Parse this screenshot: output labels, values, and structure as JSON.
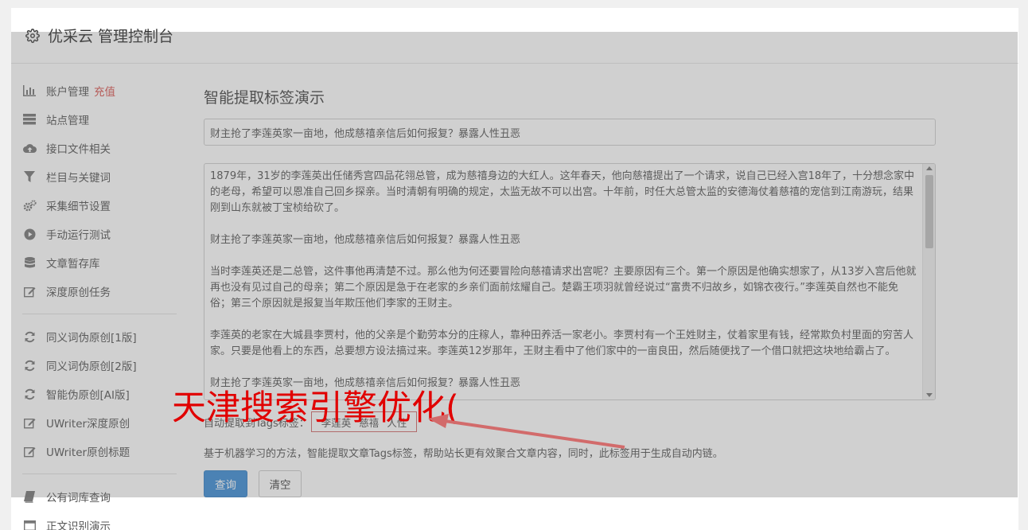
{
  "header": {
    "title": "优采云 管理控制台",
    "icon": "gear-icon"
  },
  "sidebar": {
    "group1": [
      {
        "label": "账户管理",
        "badge": "充值",
        "icon": "bar-chart-icon"
      },
      {
        "label": "站点管理",
        "icon": "server-list-icon"
      },
      {
        "label": "接口文件相关",
        "icon": "cloud-upload-icon"
      },
      {
        "label": "栏目与关键词",
        "icon": "filter-icon"
      },
      {
        "label": "采集细节设置",
        "icon": "gears-icon"
      },
      {
        "label": "手动运行测试",
        "icon": "play-circle-icon"
      },
      {
        "label": "文章暂存库",
        "icon": "database-icon"
      },
      {
        "label": "深度原创任务",
        "icon": "edit-icon"
      }
    ],
    "group2": [
      {
        "label": "同义词伪原创[1版]",
        "icon": "refresh-icon"
      },
      {
        "label": "同义词伪原创[2版]",
        "icon": "refresh-icon"
      },
      {
        "label": "智能伪原创[AI版]",
        "icon": "refresh-icon"
      },
      {
        "label": "UWriter深度原创",
        "icon": "edit-icon"
      },
      {
        "label": "UWriter原创标题",
        "icon": "edit-icon"
      }
    ],
    "group3": [
      {
        "label": "公有词库查询",
        "icon": "book-icon"
      },
      {
        "label": "正文识别演示",
        "icon": "window-icon"
      }
    ]
  },
  "main": {
    "page_title": "智能提取标签演示",
    "title_input_value": "财主抢了李莲英家一亩地，他成慈禧亲信后如何报复？暴露人性丑恶",
    "content_paragraphs": [
      "1879年，31岁的李莲英出任储秀宫四品花翎总管，成为慈禧身边的大红人。这年春天，他向慈禧提出了一个请求，说自己已经入宫18年了，十分想念家中的老母，希望可以恩准自己回乡探亲。当时清朝有明确的规定，太监无故不可以出宫。十年前，时任大总管太监的安德海仗着慈禧的宠信到江南游玩，结果刚到山东就被丁宝桢给砍了。",
      "财主抢了李莲英家一亩地，他成慈禧亲信后如何报复？暴露人性丑恶",
      "当时李莲英还是二总管，这件事他再清楚不过。那么他为何还要冒险向慈禧请求出宫呢？主要原因有三个。第一个原因是他确实想家了，从13岁入宫后他就再也没有见过自己的母亲；第二个原因是急于在老家的乡亲们面前炫耀自己。楚霸王项羽就曾经说过“富贵不归故乡，如锦衣夜行。”李莲英自然也不能免俗；第三个原因就是报复当年欺压他们李家的王财主。",
      "李莲英的老家在大城县李贾村，他的父亲是个勤劳本分的庄稼人，靠种田养活一家老小。李贾村有一个王姓财主，仗着家里有钱，经常欺负村里面的穷苦人家。只要是他看上的东西，总要想方设法搞过来。李莲英12岁那年，王财主看中了他们家中的一亩良田，然后随便找了一个借口就把这块地给霸占了。",
      "财主抢了李莲英家一亩地，他成慈禧亲信后如何报复？暴露人性丑恶"
    ],
    "tags_label": "自动提取到Tags标签：",
    "tags": [
      "李莲英",
      "慈禧",
      "人性"
    ],
    "description": "基于机器学习的方法，智能提取文章Tags标签，帮助站长更有效聚合文章内容，同时，此标签用于生成自动内链。",
    "query_button": "查询",
    "clear_button": "清空"
  },
  "watermark": {
    "text": "天津搜索引擎优化(",
    "color": "#e10000"
  },
  "colors": {
    "primary": "#3c8dd6",
    "badge": "#d9534f",
    "tag_border": "#d26b6b"
  }
}
